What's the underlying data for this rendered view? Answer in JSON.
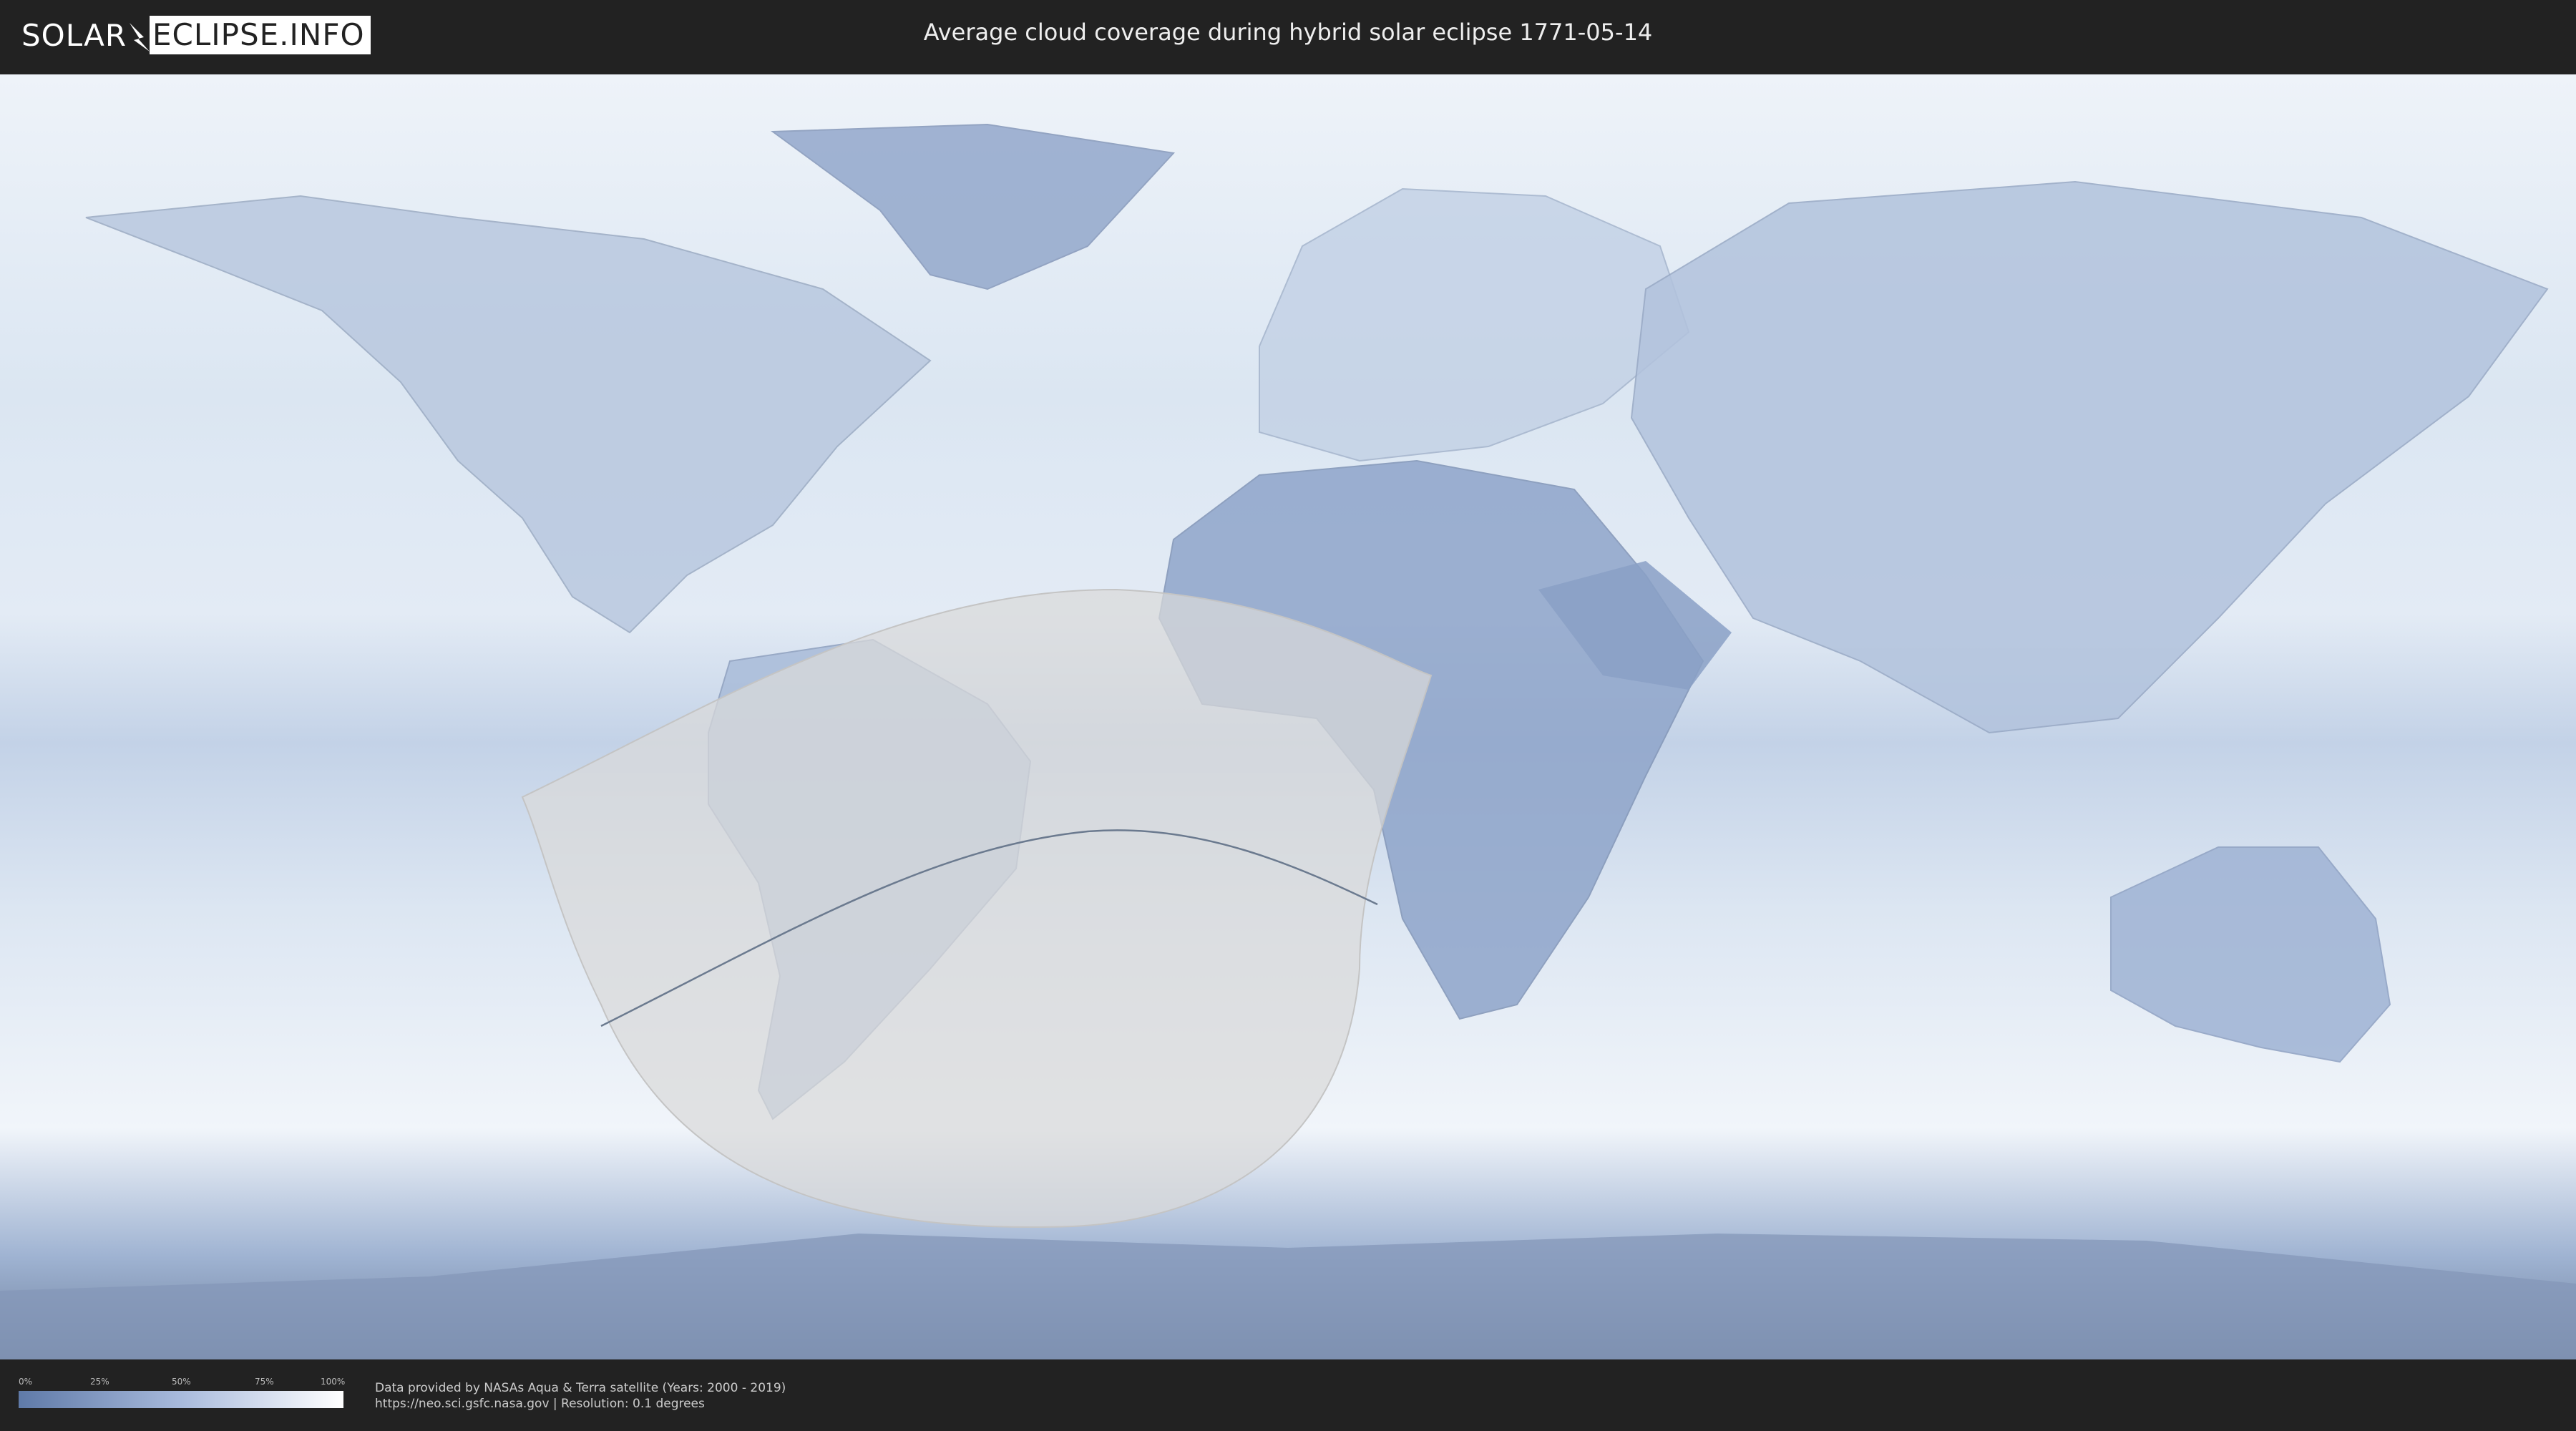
{
  "header": {
    "logo_left": "SOLAR",
    "logo_right": "ECLIPSE.INFO",
    "title": "Average cloud coverage during hybrid solar eclipse 1771-05-14"
  },
  "legend": {
    "ticks": [
      "0%",
      "25%",
      "50%",
      "75%",
      "100%"
    ],
    "gradient_colors": [
      "#5f7aa8",
      "#a8badc",
      "#ffffff"
    ]
  },
  "footer": {
    "credit_line1": "Data provided by NASAs Aqua & Terra satellite (Years: 2000 - 2019)",
    "credit_line2": "https://neo.sci.gsfc.nasa.gov | Resolution: 0.1 degrees"
  },
  "colors": {
    "background": "#222222",
    "ocean_clouds": "#dbe5f2",
    "clear_sky": "#7d93bd",
    "eclipse_zone": "#d9d9d9",
    "eclipse_path": "#6b7a8f"
  },
  "icons": {
    "logo": "lightning-bolt-icon"
  }
}
